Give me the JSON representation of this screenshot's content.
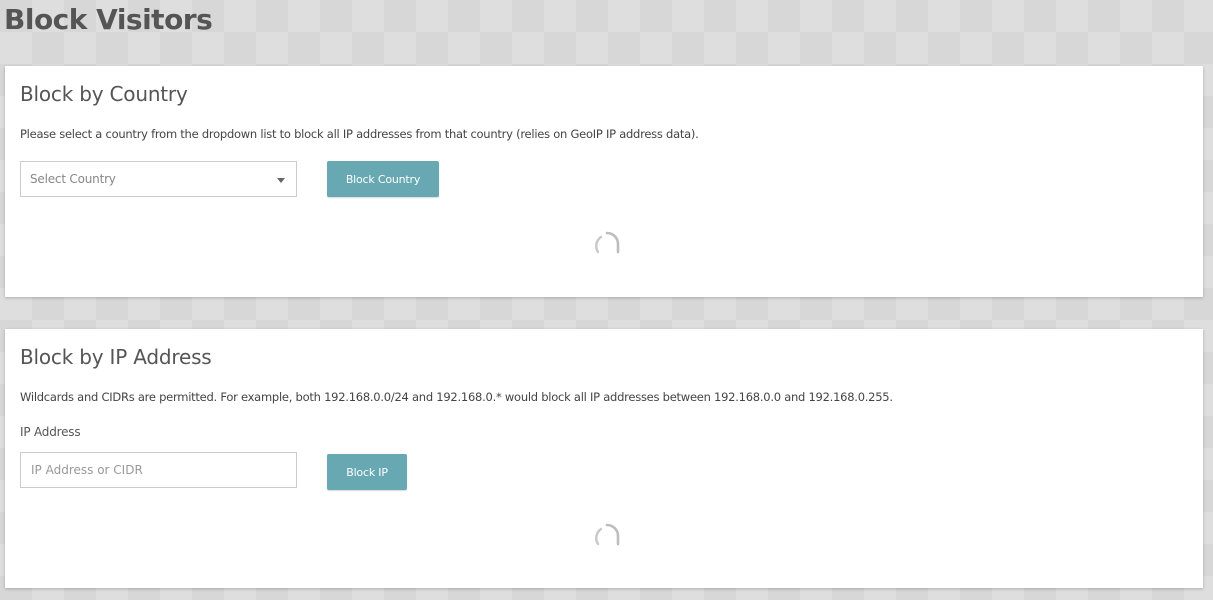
{
  "page": {
    "title": "Block Visitors"
  },
  "country_section": {
    "heading": "Block by Country",
    "description": "Please select a country from the dropdown list to block all IP addresses from that country (relies on GeoIP IP address data).",
    "select_placeholder": "Select Country",
    "button_label": "Block Country",
    "loading_icon": "spinner-icon"
  },
  "ip_section": {
    "heading": "Block by IP Address",
    "description": "Wildcards and CIDRs are permitted. For example, both 192.168.0.0/24 and 192.168.0.* would block all IP addresses between 192.168.0.0 and 192.168.0.255.",
    "field_label": "IP Address",
    "input_placeholder": "IP Address or CIDR",
    "input_value": "",
    "button_label": "Block IP",
    "loading_icon": "spinner-icon"
  },
  "colors": {
    "accent": "#67a8b2",
    "background": "#d7d7d7",
    "card": "#ffffff",
    "text": "#555555"
  }
}
